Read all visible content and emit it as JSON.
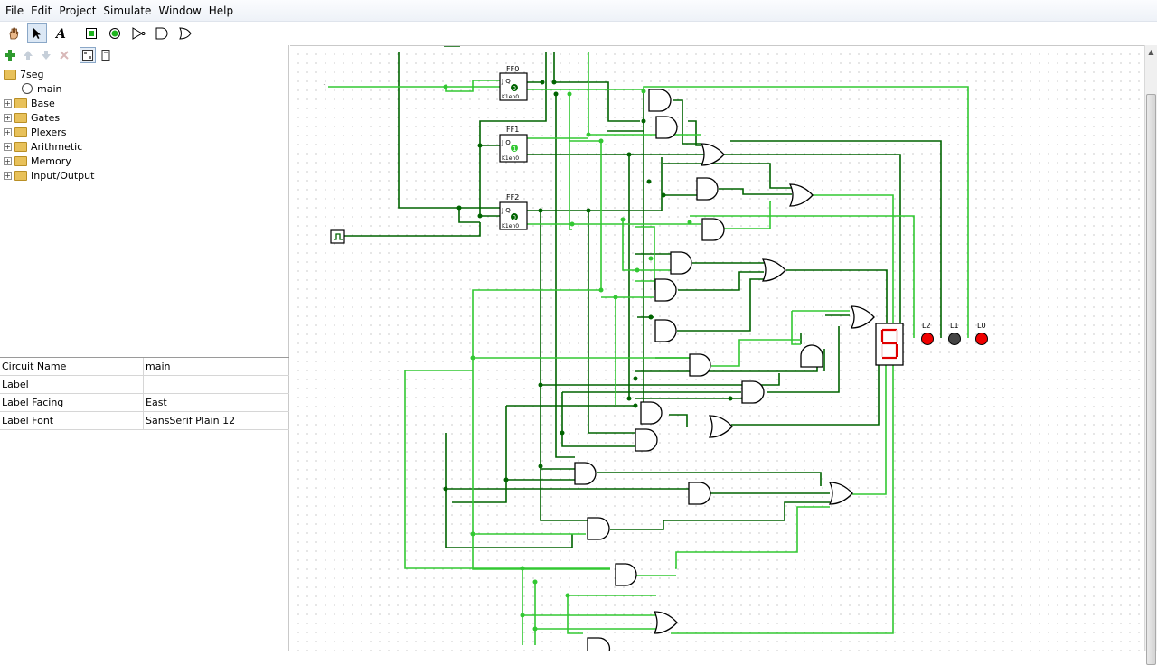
{
  "menu": [
    "File",
    "Edit",
    "Project",
    "Simulate",
    "Window",
    "Help"
  ],
  "toolbar": {
    "tools": [
      "hand-poke-icon",
      "select-arrow-icon",
      "text-tool-icon",
      "input-pin-icon",
      "output-pin-icon",
      "not-gate-icon",
      "and-gate-icon",
      "or-gate-icon"
    ]
  },
  "explorer": {
    "project": "7seg",
    "circuit": "main",
    "libraries": [
      "Base",
      "Gates",
      "Plexers",
      "Arithmetic",
      "Memory",
      "Input/Output"
    ]
  },
  "attributes": [
    {
      "key": "Circuit Name",
      "value": "main"
    },
    {
      "key": "Label",
      "value": ""
    },
    {
      "key": "Label Facing",
      "value": "East"
    },
    {
      "key": "Label Font",
      "value": "SansSerif Plain 12"
    }
  ],
  "canvas": {
    "flipflops": [
      {
        "label": "FF0",
        "state": "0",
        "pins": "J Q",
        "bottom": "K1en0"
      },
      {
        "label": "FF1",
        "state": "1",
        "pins": "J Q",
        "bottom": "K1en0"
      },
      {
        "label": "FF2",
        "state": "0",
        "pins": "J Q",
        "bottom": "K1en0"
      }
    ],
    "input_const": "1",
    "display_digit": "5",
    "leds": [
      {
        "label": "L2",
        "on": true
      },
      {
        "label": "L1",
        "on": false
      },
      {
        "label": "L0",
        "on": true
      }
    ],
    "colors": {
      "wire_high": "#32c832",
      "wire_low": "#006400",
      "led_on": "#f00000",
      "led_off": "#444444",
      "segment": "#e00000"
    }
  }
}
